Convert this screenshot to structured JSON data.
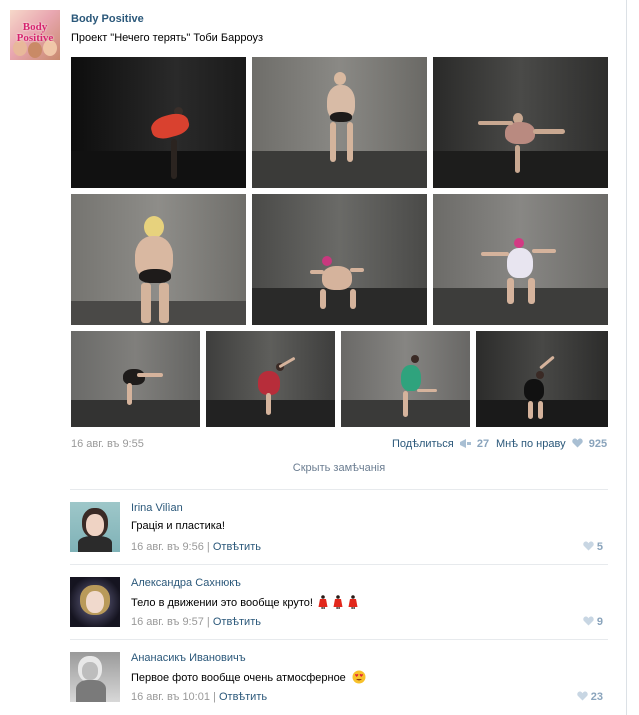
{
  "post": {
    "author": "Body Positive",
    "avatar_logo": "Body Positive",
    "text": "Проект \"Нечего терять\" Тоби Барроуз",
    "date": "16 авг. въ 9:55",
    "share_label": "Подѣлиться",
    "share_count": "27",
    "like_label": "Мнѣ по нраву",
    "like_count": "925"
  },
  "comments_toggle": "Скрыть замѣчанія",
  "comments": [
    {
      "author": "Irina Vilìan",
      "text": "Грація и пластика!",
      "date": "16 авг. въ 9:56",
      "reply": "Отвѣтить",
      "likes": "5"
    },
    {
      "author": "Александра Сахнюкъ",
      "text": "Тело в движении это вообще круто!",
      "date": "16 авг. въ 9:57",
      "reply": "Отвѣтить",
      "likes": "9",
      "emoji": [
        "dancer-emoji",
        "dancer-emoji",
        "dancer-emoji"
      ]
    },
    {
      "author": "Ананасикъ Ивановичъ",
      "text": "Первое фото вообще очень атмосферное",
      "date": "16 авг. въ 10:01",
      "reply": "Отвѣтить",
      "likes": "23",
      "emoji": [
        "heart-eyes-emoji"
      ]
    }
  ],
  "icons": {
    "share": "megaphone-icon",
    "like": "heart-icon"
  },
  "colors": {
    "link": "#2b587a",
    "muted": "#999999",
    "count": "#8aa4bc"
  }
}
